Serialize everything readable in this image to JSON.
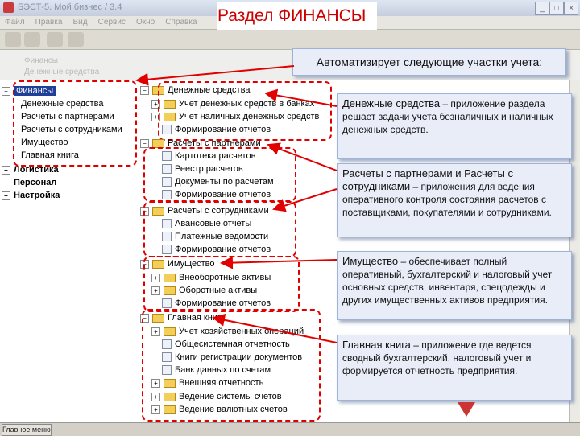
{
  "window": {
    "title": "БЭСТ-5. Мой бизнес / 3.4"
  },
  "menu": [
    "Файл",
    "Правка",
    "Вид",
    "Сервис",
    "Окно",
    "Справка"
  ],
  "faded_header": [
    "Финансы",
    "Денежные средства"
  ],
  "headline": "Раздел ФИНАНСЫ",
  "automates": "Автоматизирует следующие участки учета:",
  "nav": {
    "finance": "Финансы",
    "finance_children": [
      "Денежные средства",
      "Расчеты с партнерами",
      "Расчеты с сотрудниками",
      "Имущество",
      "Главная книга"
    ],
    "others": [
      "Логистика",
      "Персонал",
      "Настройка"
    ]
  },
  "tree": {
    "cash": "Денежные средства",
    "cash_children": [
      "Учет денежных средств в банках",
      "Учет наличных денежных средств",
      "Формирование отчетов"
    ],
    "partners": "Расчеты с партнерами",
    "partners_children": [
      "Картотека расчетов",
      "Реестр расчетов",
      "Документы по расчетам",
      "Формирование отчетов"
    ],
    "staff": "Расчеты с сотрудниками",
    "staff_children": [
      "Авансовые отчеты",
      "Платежные ведомости",
      "Формирование отчетов"
    ],
    "assets": "Имущество",
    "assets_children": [
      "Внеоборотные активы",
      "Оборотные активы",
      "Формирование отчетов"
    ],
    "ledger": "Главная книга",
    "ledger_children": [
      "Учет хозяйственных операций",
      "Общесистемная отчетность",
      "Книги регистрации документов",
      "Банк данных по счетам",
      "Внешняя отчетность",
      "Ведение системы счетов",
      "Ведение валютных счетов"
    ]
  },
  "callouts": {
    "cash_title": "Денежные средства",
    "cash_text": "– приложение раздела решает задачи учета безналичных и наличных денежных средств.",
    "partners_title": "Расчеты с партнерами и Расчеты с сотрудниками",
    "partners_text": "– приложения для ведения оперативного контроля состояния расчетов с поставщиками, покупателями и сотрудниками.",
    "assets_title": "Имущество",
    "assets_text": "– обеспечивает полный оперативный, бухгалтерский и налоговый учет основных средств, инвентаря, спецодежды и других имущественных активов предприятия.",
    "ledger_title": "Главная книга",
    "ledger_text": "– приложение где ведется сводный бухгалтерский, налоговый учет и формируется отчетность предприятия."
  },
  "statusbar": {
    "start": "Главное меню"
  },
  "colors": {
    "accent_red": "#e00000",
    "nav_selected": "#1f3f99",
    "callout_bg": "#e8edf8"
  }
}
